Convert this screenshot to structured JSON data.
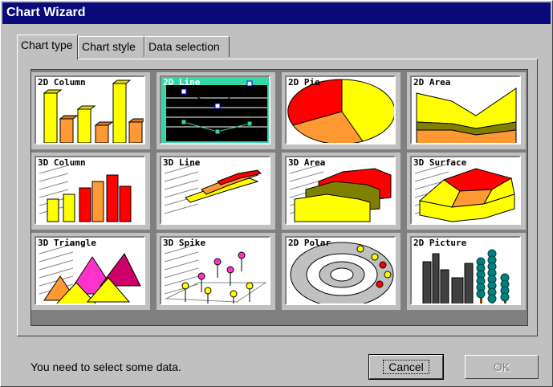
{
  "window": {
    "title": "Chart Wizard"
  },
  "tabs": [
    {
      "label": "Chart type",
      "active": true
    },
    {
      "label": "Chart style",
      "active": false
    },
    {
      "label": "Data selection",
      "active": false
    }
  ],
  "chart_types": [
    {
      "label": "2D Column",
      "icon": "2d-column-chart-icon",
      "selected": false
    },
    {
      "label": "2D Line",
      "icon": "2d-line-chart-icon",
      "selected": true
    },
    {
      "label": "2D Pie",
      "icon": "2d-pie-chart-icon",
      "selected": false
    },
    {
      "label": "2D Area",
      "icon": "2d-area-chart-icon",
      "selected": false
    },
    {
      "label": "3D Column",
      "icon": "3d-column-chart-icon",
      "selected": false
    },
    {
      "label": "3D Line",
      "icon": "3d-line-chart-icon",
      "selected": false
    },
    {
      "label": "3D Area",
      "icon": "3d-area-chart-icon",
      "selected": false
    },
    {
      "label": "3D Surface",
      "icon": "3d-surface-chart-icon",
      "selected": false
    },
    {
      "label": "3D Triangle",
      "icon": "3d-triangle-chart-icon",
      "selected": false
    },
    {
      "label": "3D Spike",
      "icon": "3d-spike-chart-icon",
      "selected": false
    },
    {
      "label": "2D Polar",
      "icon": "2d-polar-chart-icon",
      "selected": false
    },
    {
      "label": "2D Picture",
      "icon": "2d-picture-chart-icon",
      "selected": false
    }
  ],
  "status": {
    "message": "You need to select some data."
  },
  "buttons": {
    "cancel": "Cancel",
    "ok": "OK"
  },
  "colors": {
    "title_bg": "#0a0a7a",
    "selected_bg": "#33d8a8",
    "yellow": "#ffff00",
    "orange": "#ff9933",
    "red": "#ff0000",
    "olive": "#808000"
  }
}
